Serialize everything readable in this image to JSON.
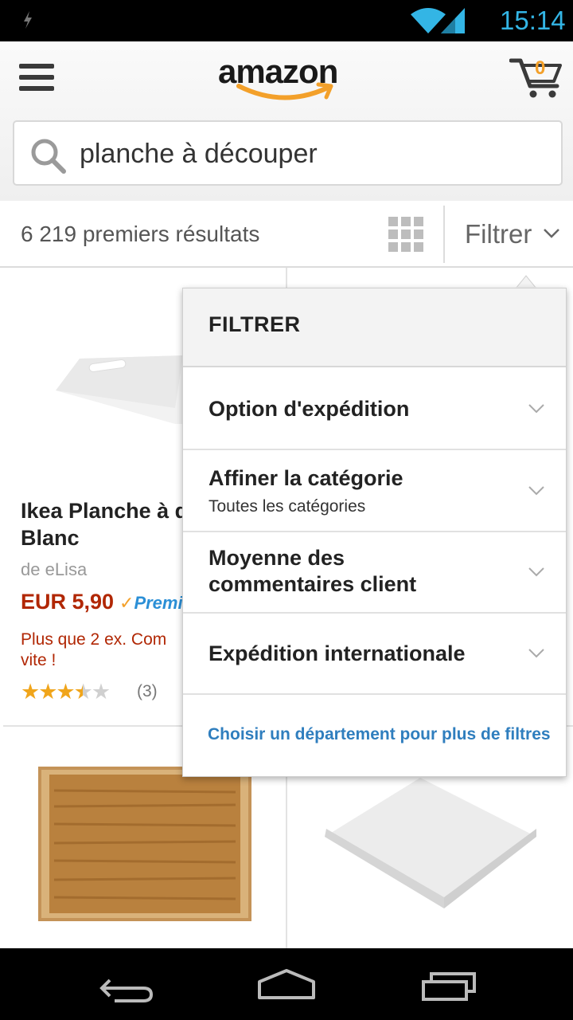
{
  "status_bar": {
    "time": "15:14",
    "accent": "#33b5e5"
  },
  "header": {
    "logo": "amazon",
    "cart_count": "0",
    "brand_orange": "#f3a02a"
  },
  "search": {
    "query": "planche à découper"
  },
  "results": {
    "count_text": "6 219 premiers résultats",
    "filter_label": "Filtrer"
  },
  "products": [
    {
      "title_line1": "Ikea Planche à d",
      "title_line2": "Blanc",
      "seller": "de eLisa",
      "price": "EUR 5,90",
      "prime": "Premi",
      "stock_line1": "Plus que 2 ex. Com",
      "stock_line2": "vite !",
      "rating": 3.5,
      "reviews": "(3)"
    },
    {
      "image": "bamboo-cutting-board"
    },
    {
      "image": "white-cutting-board"
    }
  ],
  "filter_panel": {
    "title": "FILTRER",
    "options": [
      {
        "label": "Option d'expédition",
        "sub": ""
      },
      {
        "label": "Affiner la catégorie",
        "sub": "Toutes les catégories"
      },
      {
        "label_line1": "Moyenne des",
        "label_line2": "commentaires client",
        "sub": ""
      },
      {
        "label": "Expédition internationale",
        "sub": ""
      }
    ],
    "more_link": "Choisir un département pour plus de filtres"
  },
  "nav_bar": {
    "buttons": [
      "back-icon",
      "home-icon",
      "recent-apps-icon"
    ]
  }
}
